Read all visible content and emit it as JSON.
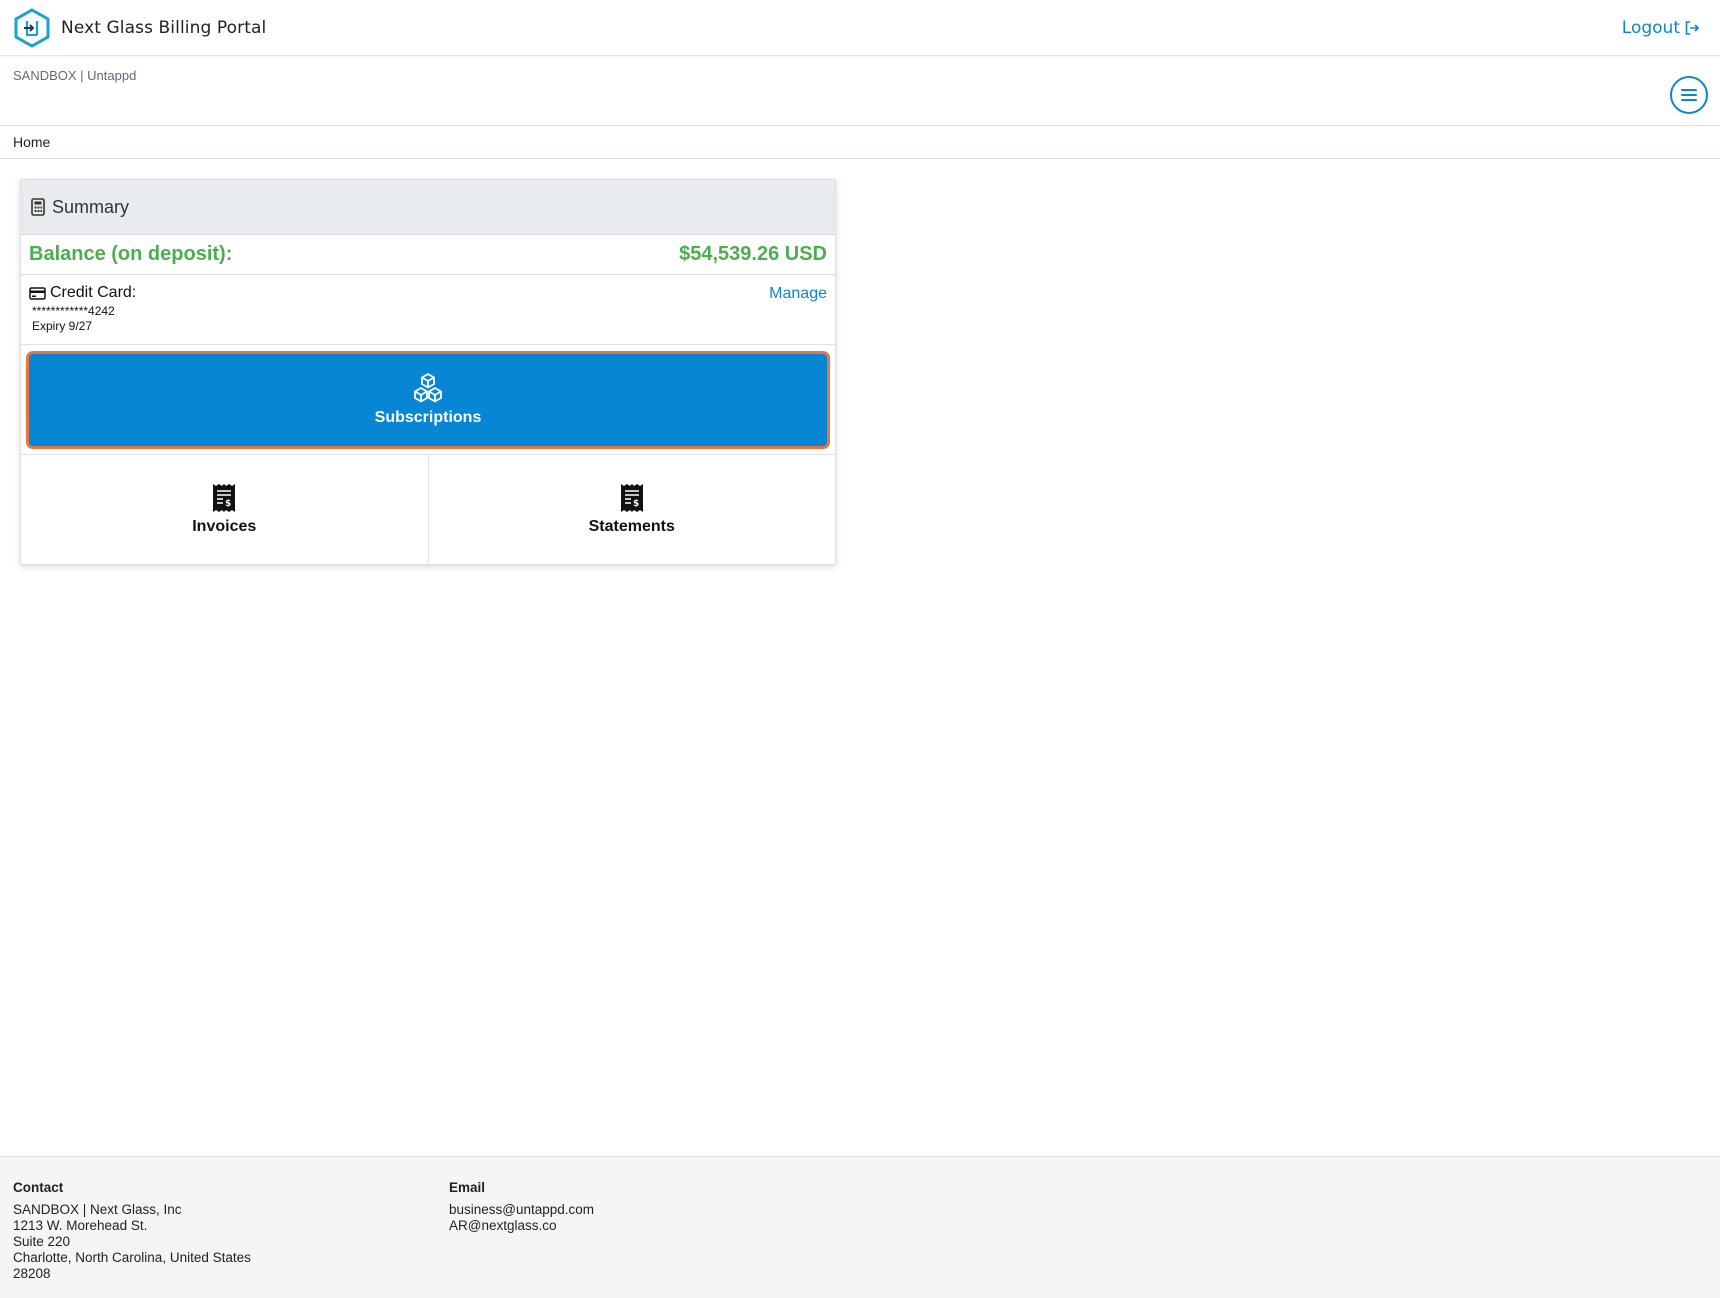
{
  "header": {
    "title": "Next Glass Billing Portal",
    "logout_label": "Logout"
  },
  "subheader": {
    "org_label": "SANDBOX | Untappd"
  },
  "breadcrumb": {
    "home": "Home"
  },
  "summary": {
    "title": "Summary",
    "balance_label": "Balance (on deposit):",
    "balance_value": "$54,539.26 USD",
    "credit_card_label": "Credit Card:",
    "card_number": "************4242",
    "card_expiry": "Expiry 9/27",
    "manage_label": "Manage",
    "subscriptions_label": "Subscriptions",
    "invoices_label": "Invoices",
    "statements_label": "Statements"
  },
  "footer": {
    "contact_heading": "Contact",
    "contact_lines": [
      "SANDBOX | Next Glass, Inc",
      "1213 W. Morehead St.",
      "Suite 220",
      "Charlotte, North Carolina, United States",
      "28208"
    ],
    "email_heading": "Email",
    "email_lines": [
      "business@untappd.com",
      "AR@nextglass.co"
    ]
  },
  "colors": {
    "accent": "#0b87d1",
    "subscriptions_button": "#0787d3",
    "highlight_outline": "#e8743f",
    "balance_green": "#4cae4f"
  },
  "icons": {
    "brand": "hexagon-logo-icon",
    "logout": "logout-icon",
    "menu": "hamburger-menu-icon",
    "summary": "calculator-icon",
    "credit_card": "credit-card-icon",
    "subscriptions": "cubes-icon",
    "invoices": "receipt-icon",
    "statements": "receipt-icon"
  }
}
